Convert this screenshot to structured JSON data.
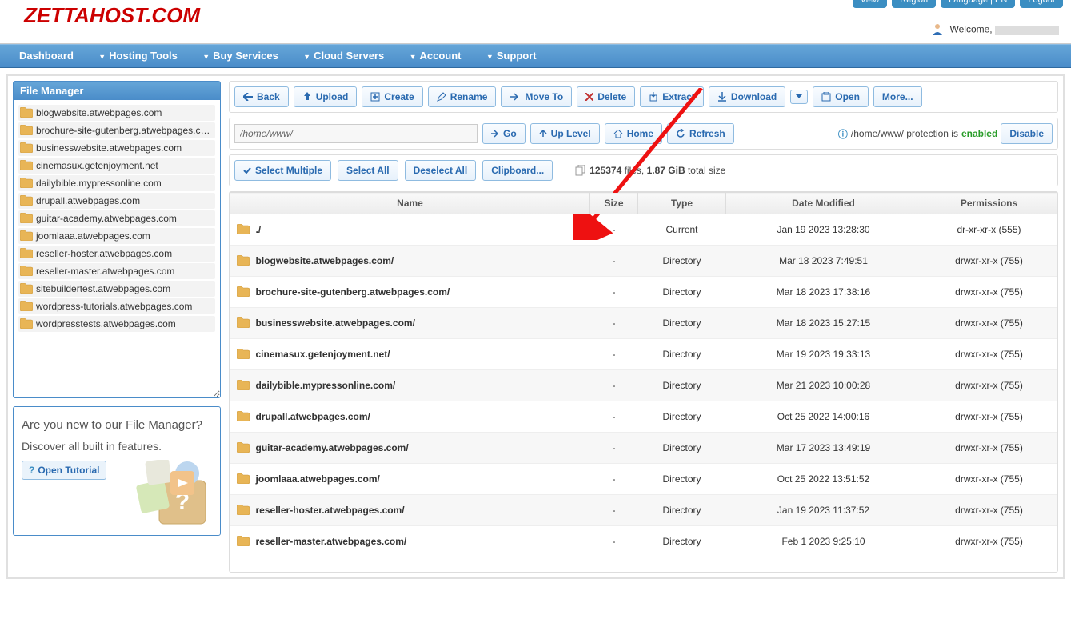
{
  "brand": "ZETTAHOST.COM",
  "welcome_label": "Welcome,",
  "top_buttons": [
    "View",
    "Region",
    "Language | EN",
    "Logout"
  ],
  "nav": [
    "Dashboard",
    "Hosting Tools",
    "Buy Services",
    "Cloud Servers",
    "Account",
    "Support"
  ],
  "sidebar": {
    "title": "File Manager",
    "items": [
      "blogwebsite.atwebpages.com",
      "brochure-site-gutenberg.atwebpages.com",
      "businesswebsite.atwebpages.com",
      "cinemasux.getenjoyment.net",
      "dailybible.mypressonline.com",
      "drupall.atwebpages.com",
      "guitar-academy.atwebpages.com",
      "joomlaaa.atwebpages.com",
      "reseller-hoster.atwebpages.com",
      "reseller-master.atwebpages.com",
      "sitebuildertest.atwebpages.com",
      "wordpress-tutorials.atwebpages.com",
      "wordpresstests.atwebpages.com"
    ],
    "promo_line1": "Are you new to our File Manager?",
    "promo_line2": "Discover all built in features.",
    "tutorial": "Open Tutorial"
  },
  "toolbar": {
    "back": "Back",
    "upload": "Upload",
    "create": "Create",
    "rename": "Rename",
    "moveto": "Move To",
    "delete": "Delete",
    "extract": "Extract",
    "download": "Download",
    "open": "Open",
    "more": "More..."
  },
  "pathbar": {
    "path": "/home/www/",
    "go": "Go",
    "up": "Up Level",
    "home": "Home",
    "refresh": "Refresh",
    "protection_pre": "/home/www/ protection is",
    "protection_status": "enabled",
    "disable": "Disable"
  },
  "selectbar": {
    "select_multiple": "Select Multiple",
    "select_all": "Select All",
    "deselect_all": "Deselect All",
    "clipboard": "Clipboard...",
    "stats_files": "125374",
    "stats_mid": " files, ",
    "stats_size": "1.87 GiB",
    "stats_suffix": " total size"
  },
  "table": {
    "headers": [
      "Name",
      "Size",
      "Type",
      "Date Modified",
      "Permissions"
    ],
    "rows": [
      {
        "name": "./",
        "size": "-",
        "type": "Current",
        "date": "Jan 19 2023 13:28:30",
        "perm": "dr-xr-xr-x (555)"
      },
      {
        "name": "blogwebsite.atwebpages.com/",
        "size": "-",
        "type": "Directory",
        "date": "Mar 18 2023 7:49:51",
        "perm": "drwxr-xr-x (755)"
      },
      {
        "name": "brochure-site-gutenberg.atwebpages.com/",
        "size": "-",
        "type": "Directory",
        "date": "Mar 18 2023 17:38:16",
        "perm": "drwxr-xr-x (755)"
      },
      {
        "name": "businesswebsite.atwebpages.com/",
        "size": "-",
        "type": "Directory",
        "date": "Mar 18 2023 15:27:15",
        "perm": "drwxr-xr-x (755)"
      },
      {
        "name": "cinemasux.getenjoyment.net/",
        "size": "-",
        "type": "Directory",
        "date": "Mar 19 2023 19:33:13",
        "perm": "drwxr-xr-x (755)"
      },
      {
        "name": "dailybible.mypressonline.com/",
        "size": "-",
        "type": "Directory",
        "date": "Mar 21 2023 10:00:28",
        "perm": "drwxr-xr-x (755)"
      },
      {
        "name": "drupall.atwebpages.com/",
        "size": "-",
        "type": "Directory",
        "date": "Oct 25 2022 14:00:16",
        "perm": "drwxr-xr-x (755)"
      },
      {
        "name": "guitar-academy.atwebpages.com/",
        "size": "-",
        "type": "Directory",
        "date": "Mar 17 2023 13:49:19",
        "perm": "drwxr-xr-x (755)"
      },
      {
        "name": "joomlaaa.atwebpages.com/",
        "size": "-",
        "type": "Directory",
        "date": "Oct 25 2022 13:51:52",
        "perm": "drwxr-xr-x (755)"
      },
      {
        "name": "reseller-hoster.atwebpages.com/",
        "size": "-",
        "type": "Directory",
        "date": "Jan 19 2023 11:37:52",
        "perm": "drwxr-xr-x (755)"
      },
      {
        "name": "reseller-master.atwebpages.com/",
        "size": "-",
        "type": "Directory",
        "date": "Feb 1 2023 9:25:10",
        "perm": "drwxr-xr-x (755)"
      }
    ]
  }
}
